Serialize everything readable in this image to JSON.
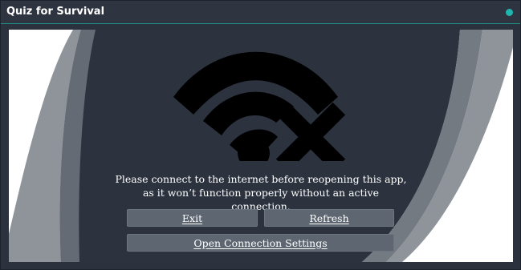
{
  "window": {
    "title": "Quiz for Survival",
    "status_color": "#1fb7ad"
  },
  "content": {
    "icon": "wifi-off-icon",
    "message": "Please connect to the internet before reopening this app, as it won’t function properly without an active connection."
  },
  "buttons": {
    "exit_label": "Exit",
    "refresh_label": "Refresh",
    "settings_label": "Open Connection Settings"
  },
  "colors": {
    "panel_background": "#2b323e",
    "button_background": "#5d6671",
    "accent": "#1fb7ad"
  }
}
